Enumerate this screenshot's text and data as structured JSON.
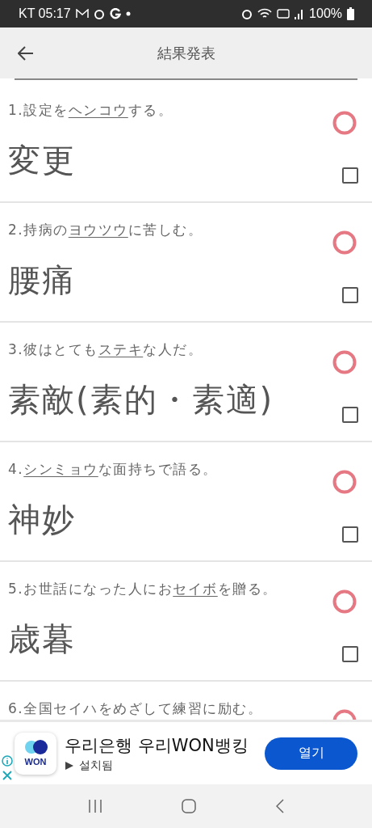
{
  "status_bar": {
    "carrier_time": "KT 05:17",
    "battery": "100%"
  },
  "header": {
    "title": "結果発表"
  },
  "questions": [
    {
      "question": [
        {
          "text": "1.設定を",
          "underlined": false
        },
        {
          "text": "ヘンコウ",
          "underlined": true
        },
        {
          "text": "する。",
          "underlined": false
        }
      ],
      "answer": "変更",
      "correct": true,
      "checked": false
    },
    {
      "question": [
        {
          "text": "2.持病の",
          "underlined": false
        },
        {
          "text": "ヨウツウ",
          "underlined": true
        },
        {
          "text": "に苦しむ。",
          "underlined": false
        }
      ],
      "answer": "腰痛",
      "correct": true,
      "checked": false
    },
    {
      "question": [
        {
          "text": "3.彼はとても",
          "underlined": false
        },
        {
          "text": "ステキ",
          "underlined": true
        },
        {
          "text": "な人だ。",
          "underlined": false
        }
      ],
      "answer": "素敵(素的・素適)",
      "correct": true,
      "checked": false
    },
    {
      "question": [
        {
          "text": "4.",
          "underlined": false
        },
        {
          "text": "シンミョウ",
          "underlined": true
        },
        {
          "text": "な面持ちで語る。",
          "underlined": false
        }
      ],
      "answer": "神妙",
      "correct": true,
      "checked": false
    },
    {
      "question": [
        {
          "text": "5.お世話になった人にお",
          "underlined": false
        },
        {
          "text": "セイボ",
          "underlined": true
        },
        {
          "text": "を贈る。",
          "underlined": false
        }
      ],
      "answer": "歳暮",
      "correct": true,
      "checked": false
    },
    {
      "question": [
        {
          "text": "6.全国セイハをめざして練習に励む。",
          "underlined": false
        }
      ],
      "correct": true
    }
  ],
  "ad": {
    "logo_text": "WON",
    "title": "우리은행 우리WON뱅킹",
    "subtitle": "설치됨",
    "button": "열기"
  }
}
